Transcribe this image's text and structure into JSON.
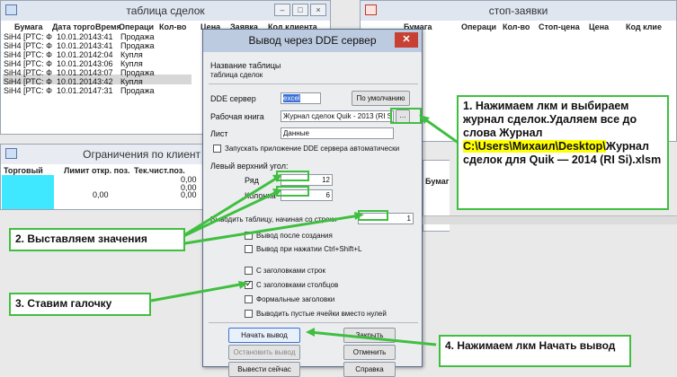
{
  "deals_window": {
    "title": "таблица сделок",
    "columns": [
      "Бумага",
      "Дата торго",
      "Время",
      "Операци",
      "Кол-во",
      "Цена",
      "Заявка",
      "Код клиента"
    ],
    "rows": [
      {
        "paper": "SiH4 [РТС: Ф",
        "date": "10.01.2014",
        "time": "3:41",
        "op": "Продажа"
      },
      {
        "paper": "SiH4 [РТС: Ф",
        "date": "10.01.2014",
        "time": "3:41",
        "op": "Продажа"
      },
      {
        "paper": "SiH4 [РТС: Ф",
        "date": "10.01.2014",
        "time": "2:04",
        "op": "Купля"
      },
      {
        "paper": "SiH4 [РТС: Ф",
        "date": "10.01.2014",
        "time": "3:06",
        "op": "Купля"
      },
      {
        "paper": "SiH4 [РТС: Ф",
        "date": "10.01.2014",
        "time": "3:07",
        "op": "Продажа"
      },
      {
        "paper": "SiH4 [РТС: Ф",
        "date": "10.01.2014",
        "time": "3:42",
        "op": "Купля"
      },
      {
        "paper": "SiH4 [РТС: Ф",
        "date": "10.01.2014",
        "time": "7:31",
        "op": "Продажа"
      }
    ]
  },
  "stop_window": {
    "title": "стоп-заявки",
    "columns": [
      "Бумага",
      "Операци",
      "Кол-во",
      "Стоп-цена",
      "Цена",
      "Код клие"
    ]
  },
  "limits_window": {
    "title": "Ограничения по клиент",
    "columns": [
      "Торговый",
      "Лимит откр. поз.",
      "Тек.чист.поз."
    ],
    "values": [
      "0,00",
      "0,00",
      "0,00",
      "0,00"
    ]
  },
  "mid_window": {
    "col": "Бумаг"
  },
  "dialog": {
    "title": "Вывод через DDE сервер",
    "table_name_label": "Название таблицы",
    "table_name_value": "таблица сделок",
    "dde_label": "DDE сервер",
    "dde_value": "excel",
    "default_button": "По умолчанию",
    "workbook_label": "Рабочая книга",
    "workbook_value": "Журнал сделок Quik - 2013 (RI S",
    "sheet_label": "Лист",
    "sheet_value": "Данные",
    "autostart_label": "Запускать приложение DDE сервера автоматически",
    "top_left_label": "Левый верхний угол:",
    "row_label": "Ряд",
    "row_value": "12",
    "col_label": "Колонка",
    "col_value": "6",
    "start_row_label": "Выводить таблицу, начиная со строки",
    "start_row_value": "1",
    "checkboxes": [
      {
        "label": "Вывод после создания",
        "checked": false
      },
      {
        "label": "Вывод при нажатии Ctrl+Shift+L",
        "checked": false
      },
      {
        "label": "С заголовками строк",
        "checked": false
      },
      {
        "label": "С заголовками столбцов",
        "checked": true
      },
      {
        "label": "Формальные заголовки",
        "checked": false
      },
      {
        "label": "Выводить пустые ячейки вместо нулей",
        "checked": false
      }
    ],
    "buttons": {
      "start": "Начать вывод",
      "close": "Закрыть",
      "stop": "Остановить вывод",
      "cancel": "Отменить",
      "now": "Вывести сейчас",
      "help": "Справка"
    }
  },
  "callouts": {
    "c1_a": "1. Нажимаем лкм и выбираем журнал сделок.Удаляем все до слова Журнал",
    "c1_path": "C:\\Users\\Михаил\\Desktop\\",
    "c1_b": "Журнал сделок для Quik — 2014 (RI Si).xlsm",
    "c2": "2. Выставляем значения",
    "c3": "3. Ставим галочку",
    "c4": "4. Нажимаем лкм Начать вывод"
  },
  "colors": {
    "highlight": "#ffff00",
    "callout_border": "#3fbf3f",
    "arrow": "#3fbf3f",
    "dialog_title": "#bccbe0",
    "close_red": "#c84033"
  }
}
